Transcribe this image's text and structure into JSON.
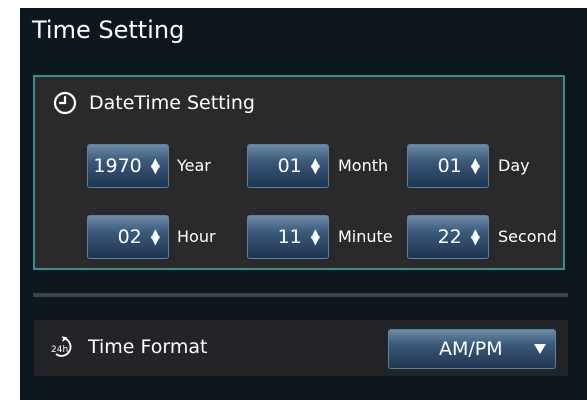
{
  "title": "Time Setting",
  "datetime": {
    "heading": "DateTime Setting",
    "icon": "clock-icon",
    "fields": [
      {
        "value": "1970",
        "unit": "Year"
      },
      {
        "value": "01",
        "unit": "Month"
      },
      {
        "value": "01",
        "unit": "Day"
      },
      {
        "value": "02",
        "unit": "Hour"
      },
      {
        "value": "11",
        "unit": "Minute"
      },
      {
        "value": "22",
        "unit": "Second"
      }
    ]
  },
  "time_format": {
    "icon": "24h-clock-icon",
    "label": "Time Format",
    "icon_text": "24h",
    "selected": "AM/PM"
  },
  "colors": {
    "background": "#0f171e",
    "panel_border": "#3a8d8b",
    "control_top": "#6a8aa6",
    "control_bottom": "#1e3552"
  }
}
